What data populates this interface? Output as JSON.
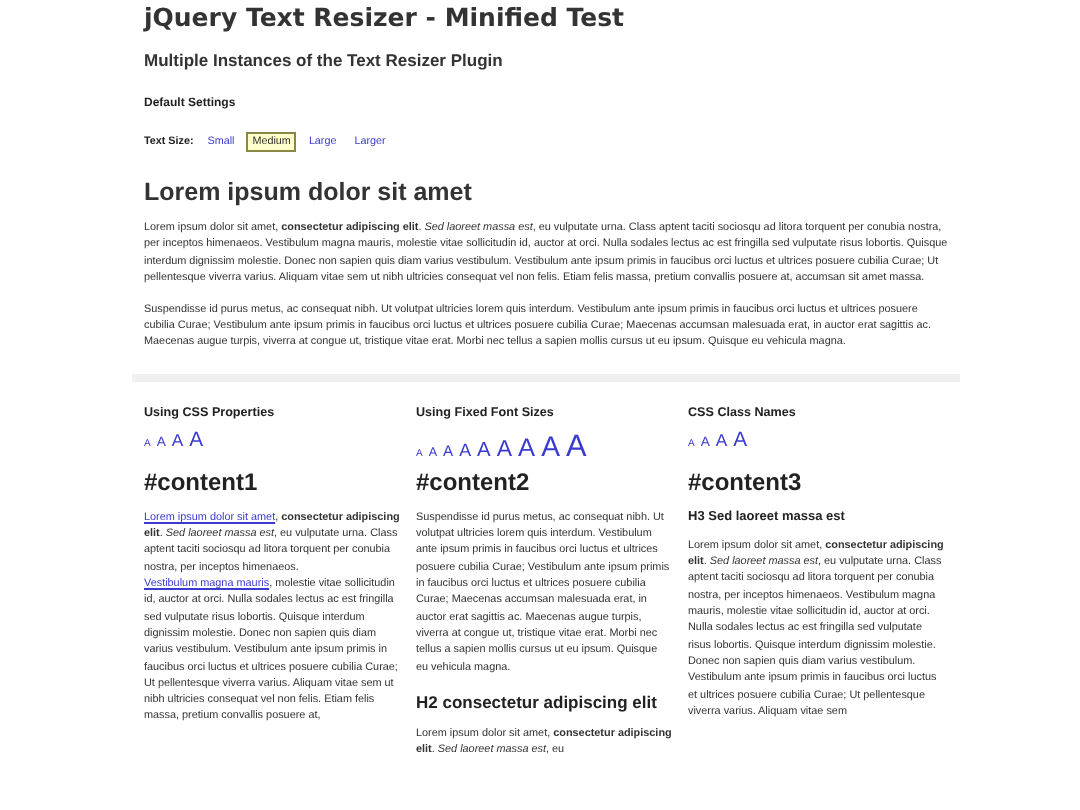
{
  "page": {
    "title": "jQuery Text Resizer - Minified Test",
    "subtitle": "Multiple Instances of the Text Resizer Plugin"
  },
  "default_settings": {
    "heading": "Default Settings",
    "label": "Text Size:",
    "sizes": [
      {
        "label": "Small",
        "selected": false
      },
      {
        "label": "Medium",
        "selected": true
      },
      {
        "label": "Large",
        "selected": false
      },
      {
        "label": "Larger",
        "selected": false
      }
    ]
  },
  "article": {
    "heading": "Lorem ipsum dolor sit amet",
    "paragraphs": [
      "Lorem ipsum dolor sit amet, **consectetur adipiscing elit**. *Sed laoreet massa est*, eu vulputate urna. Class aptent taciti sociosqu ad litora torquent per conubia nostra, per inceptos himenaeos. Vestibulum magna mauris, molestie vitae sollicitudin id, auctor at orci. Nulla sodales lectus ac est fringilla sed vulputate risus lobortis. Quisque interdum dignissim molestie. Donec non sapien quis diam varius vestibulum. Vestibulum ante ipsum primis in faucibus orci luctus et ultrices posuere cubilia Curae; Ut pellentesque viverra varius. Aliquam vitae sem ut nibh ultricies consequat vel non felis. Etiam felis massa, pretium convallis posuere at, accumsan sit amet massa.",
      "Suspendisse id purus metus, ac consequat nibh. Ut volutpat ultricies lorem quis interdum. Vestibulum ante ipsum primis in faucibus orci luctus et ultrices posuere cubilia Curae; Vestibulum ante ipsum primis in faucibus orci luctus et ultrices posuere cubilia Curae; Maecenas accumsan malesuada erat, in auctor erat sagittis ac. Maecenas augue turpis, viverra at congue ut, tristique vitae erat. Morbi nec tellus a sapien mollis cursus ut eu ipsum. Quisque eu vehicula magna."
    ]
  },
  "columns": [
    {
      "title": "Using CSS Properties",
      "sizes": [
        "A",
        "A",
        "A",
        "A"
      ],
      "heading": "#content1",
      "blocks": [
        {
          "kind": "paragraph",
          "segments": [
            {
              "kind": "link",
              "text": "Lorem ipsum dolor sit amet"
            },
            {
              "kind": "text",
              "text": ", **consectetur adipiscing elit**. *Sed laoreet massa est*, eu vulputate urna. Class aptent taciti sociosqu ad litora torquent per conubia nostra, per inceptos himenaeos. "
            },
            {
              "kind": "link",
              "text": "Vestibulum magna mauris"
            },
            {
              "kind": "text",
              "text": ", molestie vitae sollicitudin id, auctor at orci. Nulla sodales lectus ac est fringilla sed vulputate risus lobortis. Quisque interdum dignissim molestie. Donec non sapien quis diam varius vestibulum. Vestibulum ante ipsum primis in faucibus orci luctus et ultrices posuere cubilia Curae; Ut pellentesque viverra varius. Aliquam vitae sem ut nibh ultricies consequat vel non felis. Etiam felis massa, pretium convallis posuere at,"
            }
          ]
        }
      ]
    },
    {
      "title": "Using Fixed Font Sizes",
      "sizes": [
        "A",
        "A",
        "A",
        "A",
        "A",
        "A",
        "A",
        "A",
        "A"
      ],
      "heading": "#content2",
      "blocks": [
        {
          "kind": "paragraph",
          "segments": [
            {
              "kind": "text",
              "text": "Suspendisse id purus metus, ac consequat nibh. Ut volutpat ultricies lorem quis interdum. Vestibulum ante ipsum primis in faucibus orci luctus et ultrices posuere cubilia Curae; Vestibulum ante ipsum primis in faucibus orci luctus et ultrices posuere cubilia Curae; Maecenas accumsan malesuada erat, in auctor erat sagittis ac. Maecenas augue turpis, viverra at congue ut, tristique vitae erat. Morbi nec tellus a sapien mollis cursus ut eu ipsum. Quisque eu vehicula magna."
            }
          ]
        },
        {
          "kind": "h2",
          "text": "H2 consectetur adipiscing elit"
        },
        {
          "kind": "paragraph",
          "segments": [
            {
              "kind": "text",
              "text": "Lorem ipsum dolor sit amet, **consectetur adipiscing elit**. *Sed laoreet massa est*, eu"
            }
          ]
        }
      ]
    },
    {
      "title": "CSS Class Names",
      "sizes": [
        "A",
        "A",
        "A",
        "A"
      ],
      "heading": "#content3",
      "blocks": [
        {
          "kind": "h3",
          "text": "H3 Sed laoreet massa est"
        },
        {
          "kind": "paragraph",
          "segments": [
            {
              "kind": "text",
              "text": "Lorem ipsum dolor sit amet, **consectetur adipiscing elit**. *Sed laoreet massa est*, eu vulputate urna. Class aptent taciti sociosqu ad litora torquent per conubia nostra, per inceptos himenaeos. Vestibulum magna mauris, molestie vitae sollicitudin id, auctor at orci. Nulla sodales lectus ac est fringilla sed vulputate risus lobortis. Quisque interdum dignissim molestie. Donec non sapien quis diam varius vestibulum. Vestibulum ante ipsum primis in faucibus orci luctus et ultrices posuere cubilia Curae; Ut pellentesque viverra varius. Aliquam vitae sem"
            }
          ]
        }
      ]
    }
  ]
}
